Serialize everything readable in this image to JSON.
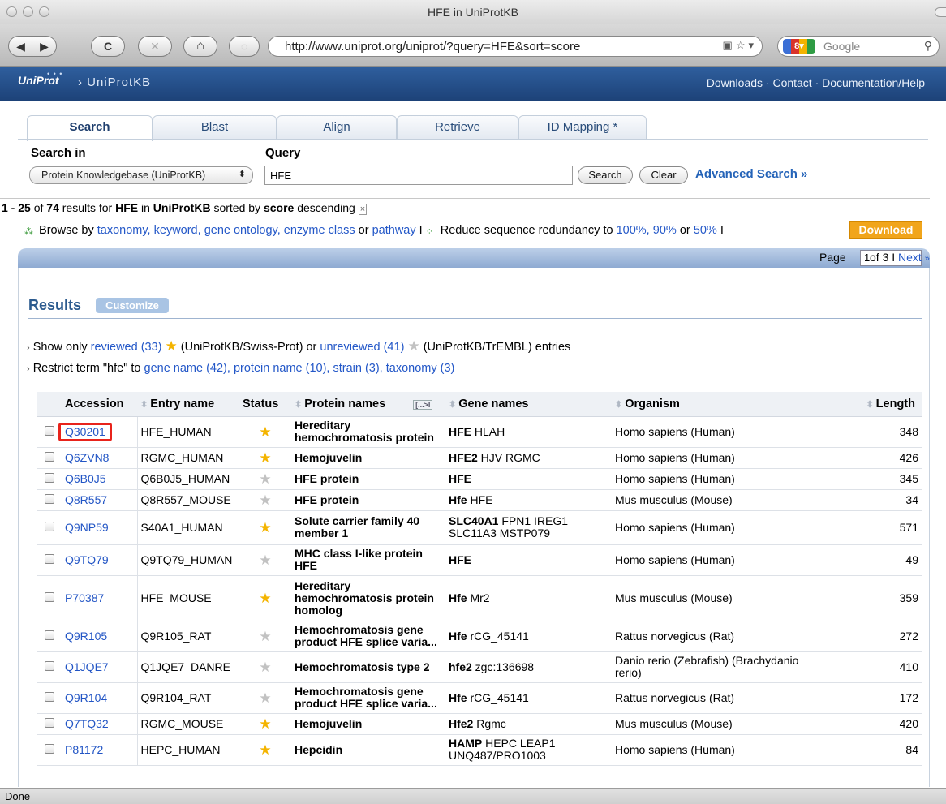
{
  "window": {
    "title": "HFE in UniProtKB"
  },
  "browser": {
    "back": "◀",
    "forward": "▶",
    "reload": "C",
    "stop": "✕",
    "home": "⌂",
    "url": "http://www.uniprot.org/uniprot/?query=HFE&sort=score",
    "search_placeholder": "Google"
  },
  "header": {
    "logo": "UniProt",
    "breadcrumb": "› UniProtKB",
    "links": "Downloads · Contact · Documentation/Help"
  },
  "tabs": [
    "Search",
    "Blast",
    "Align",
    "Retrieve",
    "ID Mapping *"
  ],
  "search": {
    "search_in_label": "Search in",
    "query_label": "Query",
    "database": "Protein Knowledgebase (UniProtKB)",
    "query": "HFE",
    "search_btn": "Search",
    "clear_btn": "Clear",
    "advanced": "Advanced Search »"
  },
  "result_summary": {
    "range": "1 - 25",
    "of": " of ",
    "total": "74",
    "for": " results for ",
    "term": "HFE",
    "in": " in ",
    "db": "UniProtKB",
    "sorted": " sorted by ",
    "sortkey": "score",
    "order": " descending"
  },
  "browse": {
    "prefix": "Browse by",
    "taxonomy": "taxonomy,",
    "keyword": "keyword,",
    "go": "gene ontology,",
    "enzyme": "enzyme class",
    "or1": "or",
    "pathway": "pathway",
    "sep": "I",
    "reduce": "Reduce sequence redundancy to",
    "r100": "100%,",
    "r90": "90%",
    "or2": "or",
    "r50": "50%",
    "sep2": "I",
    "download": "Download"
  },
  "pager": {
    "label": "Page",
    "value": "1",
    "of": "of 3 I",
    "next": "Next",
    "arrow": "»"
  },
  "results": {
    "title": "Results",
    "customize": "Customize",
    "show_only": "Show only",
    "reviewed": "reviewed (33)",
    "swissprot": "(UniProtKB/Swiss-Prot) or",
    "unreviewed": "unreviewed (41)",
    "trembl": "(UniProtKB/TrEMBL) entries",
    "restrict": "Restrict term \"hfe\" to",
    "gene_name": "gene name (42),",
    "protein_name": "protein name (10),",
    "strain": "strain (3),",
    "taxonomy": "taxonomy (3)"
  },
  "columns": [
    "Accession",
    "Entry name",
    "Status",
    "Protein names",
    "Gene names",
    "Organism",
    "Length"
  ],
  "col_btn": "[...>I",
  "rows": [
    {
      "acc": "Q30201",
      "entry": "HFE_HUMAN",
      "reviewed": true,
      "protein": "Hereditary hemochromatosis protein",
      "gene_main": "HFE",
      "gene_rest": " HLAH",
      "organism": "Homo sapiens (Human)",
      "length": "348"
    },
    {
      "acc": "Q6ZVN8",
      "entry": "RGMC_HUMAN",
      "reviewed": true,
      "protein": "Hemojuvelin",
      "gene_main": "HFE2",
      "gene_rest": " HJV RGMC",
      "organism": "Homo sapiens (Human)",
      "length": "426"
    },
    {
      "acc": "Q6B0J5",
      "entry": "Q6B0J5_HUMAN",
      "reviewed": false,
      "protein": "HFE protein",
      "gene_main": "HFE",
      "gene_rest": "",
      "organism": "Homo sapiens (Human)",
      "length": "345"
    },
    {
      "acc": "Q8R557",
      "entry": "Q8R557_MOUSE",
      "reviewed": false,
      "protein": "HFE protein",
      "gene_main": "Hfe",
      "gene_rest": " HFE",
      "organism": "Mus musculus (Mouse)",
      "length": "34"
    },
    {
      "acc": "Q9NP59",
      "entry": "S40A1_HUMAN",
      "reviewed": true,
      "protein": "Solute carrier family 40 member 1",
      "gene_main": "SLC40A1",
      "gene_rest": " FPN1 IREG1 SLC11A3 MSTP079",
      "organism": "Homo sapiens (Human)",
      "length": "571"
    },
    {
      "acc": "Q9TQ79",
      "entry": "Q9TQ79_HUMAN",
      "reviewed": false,
      "protein": "MHC class I-like protein HFE",
      "gene_main": "HFE",
      "gene_rest": "",
      "organism": "Homo sapiens (Human)",
      "length": "49"
    },
    {
      "acc": "P70387",
      "entry": "HFE_MOUSE",
      "reviewed": true,
      "protein": "Hereditary hemochromatosis protein homolog",
      "gene_main": "Hfe",
      "gene_rest": " Mr2",
      "organism": "Mus musculus (Mouse)",
      "length": "359"
    },
    {
      "acc": "Q9R105",
      "entry": "Q9R105_RAT",
      "reviewed": false,
      "protein": "Hemochromatosis gene product HFE splice varia...",
      "gene_main": "Hfe",
      "gene_rest": " rCG_45141",
      "organism": "Rattus norvegicus (Rat)",
      "length": "272"
    },
    {
      "acc": "Q1JQE7",
      "entry": "Q1JQE7_DANRE",
      "reviewed": false,
      "protein": "Hemochromatosis type 2",
      "gene_main": "hfe2",
      "gene_rest": " zgc:136698",
      "organism": "Danio rerio (Zebrafish) (Brachydanio rerio)",
      "length": "410"
    },
    {
      "acc": "Q9R104",
      "entry": "Q9R104_RAT",
      "reviewed": false,
      "protein": "Hemochromatosis gene product HFE splice varia...",
      "gene_main": "Hfe",
      "gene_rest": " rCG_45141",
      "organism": "Rattus norvegicus (Rat)",
      "length": "172"
    },
    {
      "acc": "Q7TQ32",
      "entry": "RGMC_MOUSE",
      "reviewed": true,
      "protein": "Hemojuvelin",
      "gene_main": "Hfe2",
      "gene_rest": " Rgmc",
      "organism": "Mus musculus (Mouse)",
      "length": "420"
    },
    {
      "acc": "P81172",
      "entry": "HEPC_HUMAN",
      "reviewed": true,
      "protein": "Hepcidin",
      "gene_main": "HAMP",
      "gene_rest": " HEPC LEAP1 UNQ487/PRO1003",
      "organism": "Homo sapiens (Human)",
      "length": "84"
    }
  ],
  "highlighted_accession": "Q30201",
  "colors": {
    "link": "#2255c5",
    "header_bg": "#2f5f9e",
    "highlight": "#e8231b",
    "star_reviewed": "#f4b400",
    "star_unreviewed": "#c2c2c2",
    "download": "#f1a51b"
  },
  "statusbar": "Done"
}
